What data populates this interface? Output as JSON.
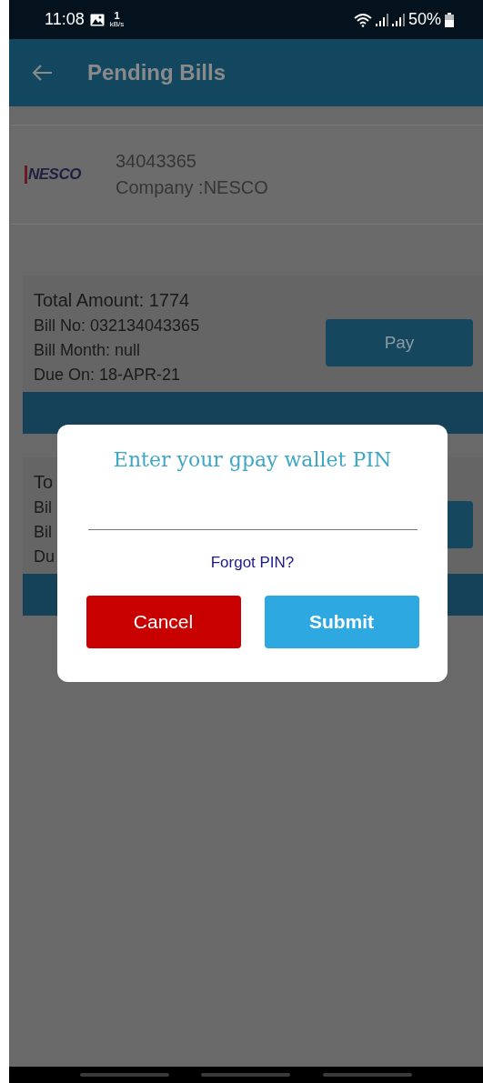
{
  "status_bar": {
    "time": "11:08",
    "speed_value": "1",
    "speed_unit": "kB/s",
    "battery": "50%"
  },
  "app_bar": {
    "title": "Pending Bills"
  },
  "account": {
    "logo_text": "NESCO",
    "number": "34043365",
    "company": "Company :NESCO"
  },
  "bills": [
    {
      "lines": [
        "Total Amount: 1774",
        "Bill No: 032134043365",
        "Bill Month: null",
        "Due On: 18-APR-21"
      ],
      "pay_button": "Pay"
    },
    {
      "lines": [
        "To",
        "Bil",
        "Bil",
        "Du"
      ]
    }
  ],
  "dialog": {
    "title": "Enter your gpay wallet PIN",
    "forgot_link": "Forgot PIN?",
    "buttons": [
      {
        "label": "Cancel",
        "kind": "cancel"
      },
      {
        "label": "Submit",
        "kind": "submit"
      }
    ]
  }
}
